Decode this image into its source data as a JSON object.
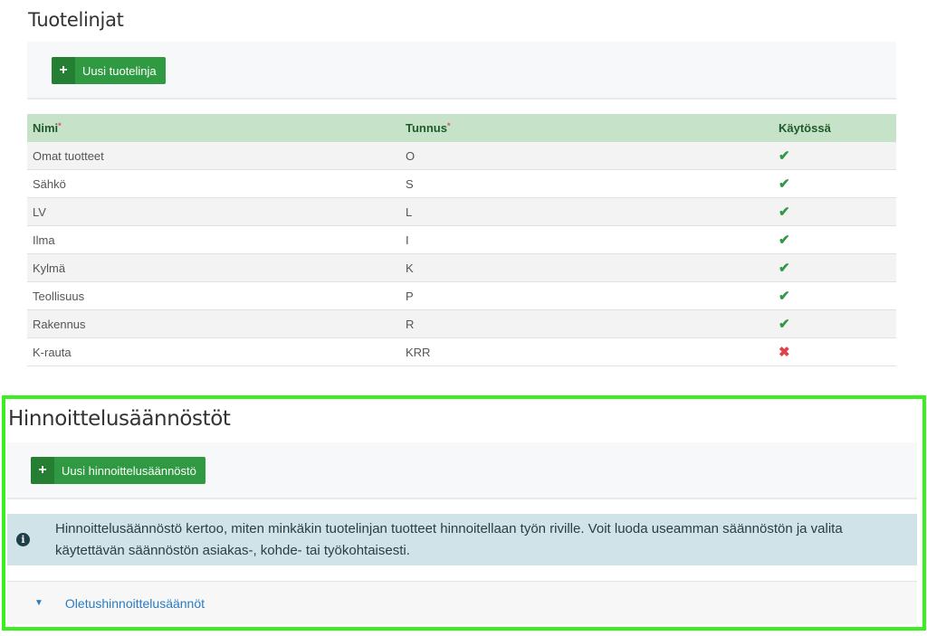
{
  "product_lines": {
    "title": "Tuotelinjat",
    "new_button": {
      "icon": "plus-icon",
      "label": "Uusi tuotelinja"
    },
    "columns": {
      "name": "Nimi",
      "code": "Tunnus",
      "active": "Käytössä",
      "required_marker": "*"
    },
    "rows": [
      {
        "name": "Omat tuotteet",
        "code": "O",
        "active": true,
        "mark": "✔"
      },
      {
        "name": "Sähkö",
        "code": "S",
        "active": true,
        "mark": "✔"
      },
      {
        "name": "LV",
        "code": "L",
        "active": true,
        "mark": "✔"
      },
      {
        "name": "Ilma",
        "code": "I",
        "active": true,
        "mark": "✔"
      },
      {
        "name": "Kylmä",
        "code": "K",
        "active": true,
        "mark": "✔"
      },
      {
        "name": "Teollisuus",
        "code": "P",
        "active": true,
        "mark": "✔"
      },
      {
        "name": "Rakennus",
        "code": "R",
        "active": true,
        "mark": "✔"
      },
      {
        "name": "K-rauta",
        "code": "KRR",
        "active": false,
        "mark": "✖"
      }
    ]
  },
  "pricing_rules": {
    "title": "Hinnoittelusäännöstöt",
    "new_button": {
      "icon": "plus-icon",
      "label": "Uusi hinnoittelusäännöstö"
    },
    "info": {
      "icon": "info-icon",
      "text": "Hinnoittelusäännöstö kertoo, miten minkäkin tuotelinjan tuotteet hinnoitellaan työn riville. Voit luoda useamman säännöstön ja valita käytettävän säännöstön asiakas-, kohde- tai työkohtaisesti."
    },
    "default_rules": {
      "icon": "caret-down-icon",
      "label": "Oletushinnoittelusäännöt"
    }
  },
  "colors": {
    "accent_green": "#2f9a41",
    "header_green": "#c6e3c9",
    "highlight": "#3aee1f",
    "info_bg": "#cfe3e8",
    "link_blue": "#2a7bbf"
  }
}
